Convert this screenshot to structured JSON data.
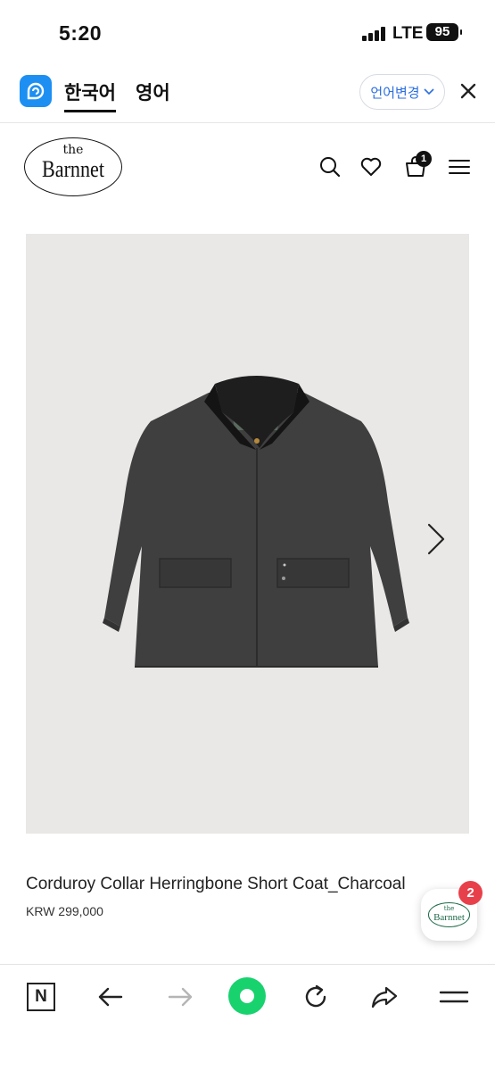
{
  "status_bar": {
    "time": "5:20",
    "network": "LTE",
    "battery": "95"
  },
  "translate_bar": {
    "tab_korean": "한국어",
    "tab_english": "영어",
    "change_language": "언어변경",
    "icons": [
      "papago-icon",
      "chevron-down-icon",
      "close-icon"
    ]
  },
  "site_header": {
    "logo_the": "the",
    "logo_name": "Barnnet",
    "cart_count": "1",
    "icons": [
      "search-icon",
      "heart-icon",
      "cart-icon",
      "menu-icon"
    ]
  },
  "product": {
    "name": "Corduroy Collar Herringbone Short Coat_Charcoal",
    "price": "KRW 299,000",
    "image": "charcoal herringbone short coat with black corduroy collar"
  },
  "floating_chat": {
    "logo_the": "the",
    "logo_name": "Barnnet",
    "badge_count": "2"
  },
  "browser_bar": {
    "n_label": "N",
    "icons": [
      "naver-n-icon",
      "back-arrow-icon",
      "forward-arrow-icon",
      "green-home-icon",
      "refresh-icon",
      "share-icon",
      "menu-icon"
    ]
  },
  "colors": {
    "accent_blue": "#2b6fe0",
    "papago_blue": "#1d8ff2",
    "badge_red": "#e8404a",
    "naver_green": "#18d26e",
    "image_bg": "#e9e8e6"
  }
}
